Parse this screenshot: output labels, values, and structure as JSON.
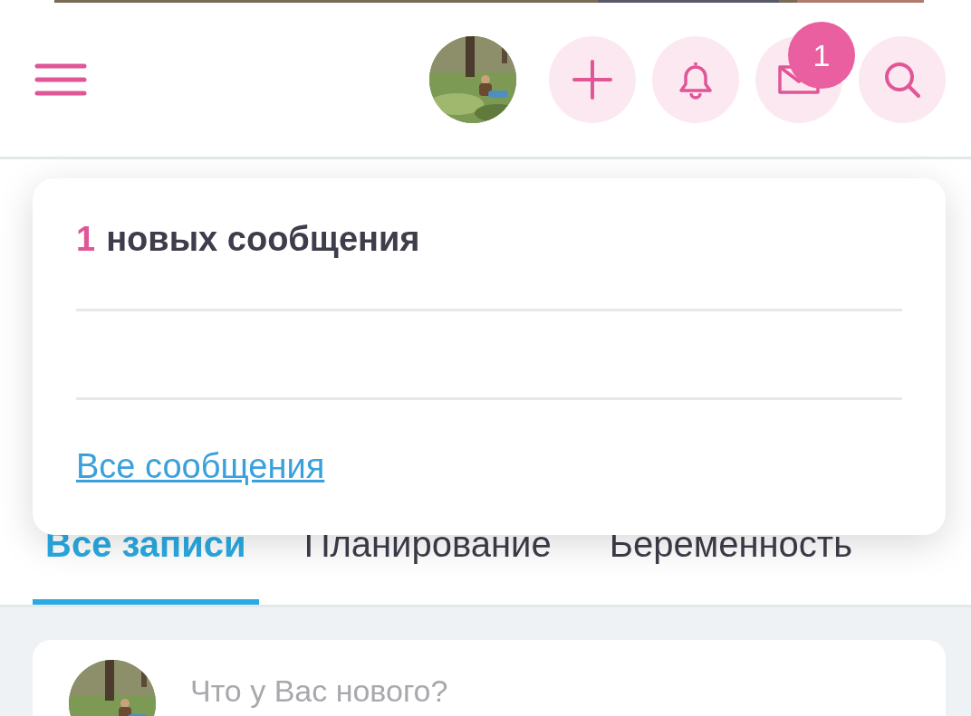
{
  "header": {
    "mail_badge": "1"
  },
  "notifications": {
    "count": "1",
    "title": "новых сообщения",
    "link": "Все сообщения"
  },
  "tabs": [
    {
      "label": "Все записи",
      "selected": true
    },
    {
      "label": "Планирование",
      "selected": false
    },
    {
      "label": "Беременность",
      "selected": false
    }
  ],
  "composer": {
    "placeholder": "Что у Вас нового?"
  }
}
